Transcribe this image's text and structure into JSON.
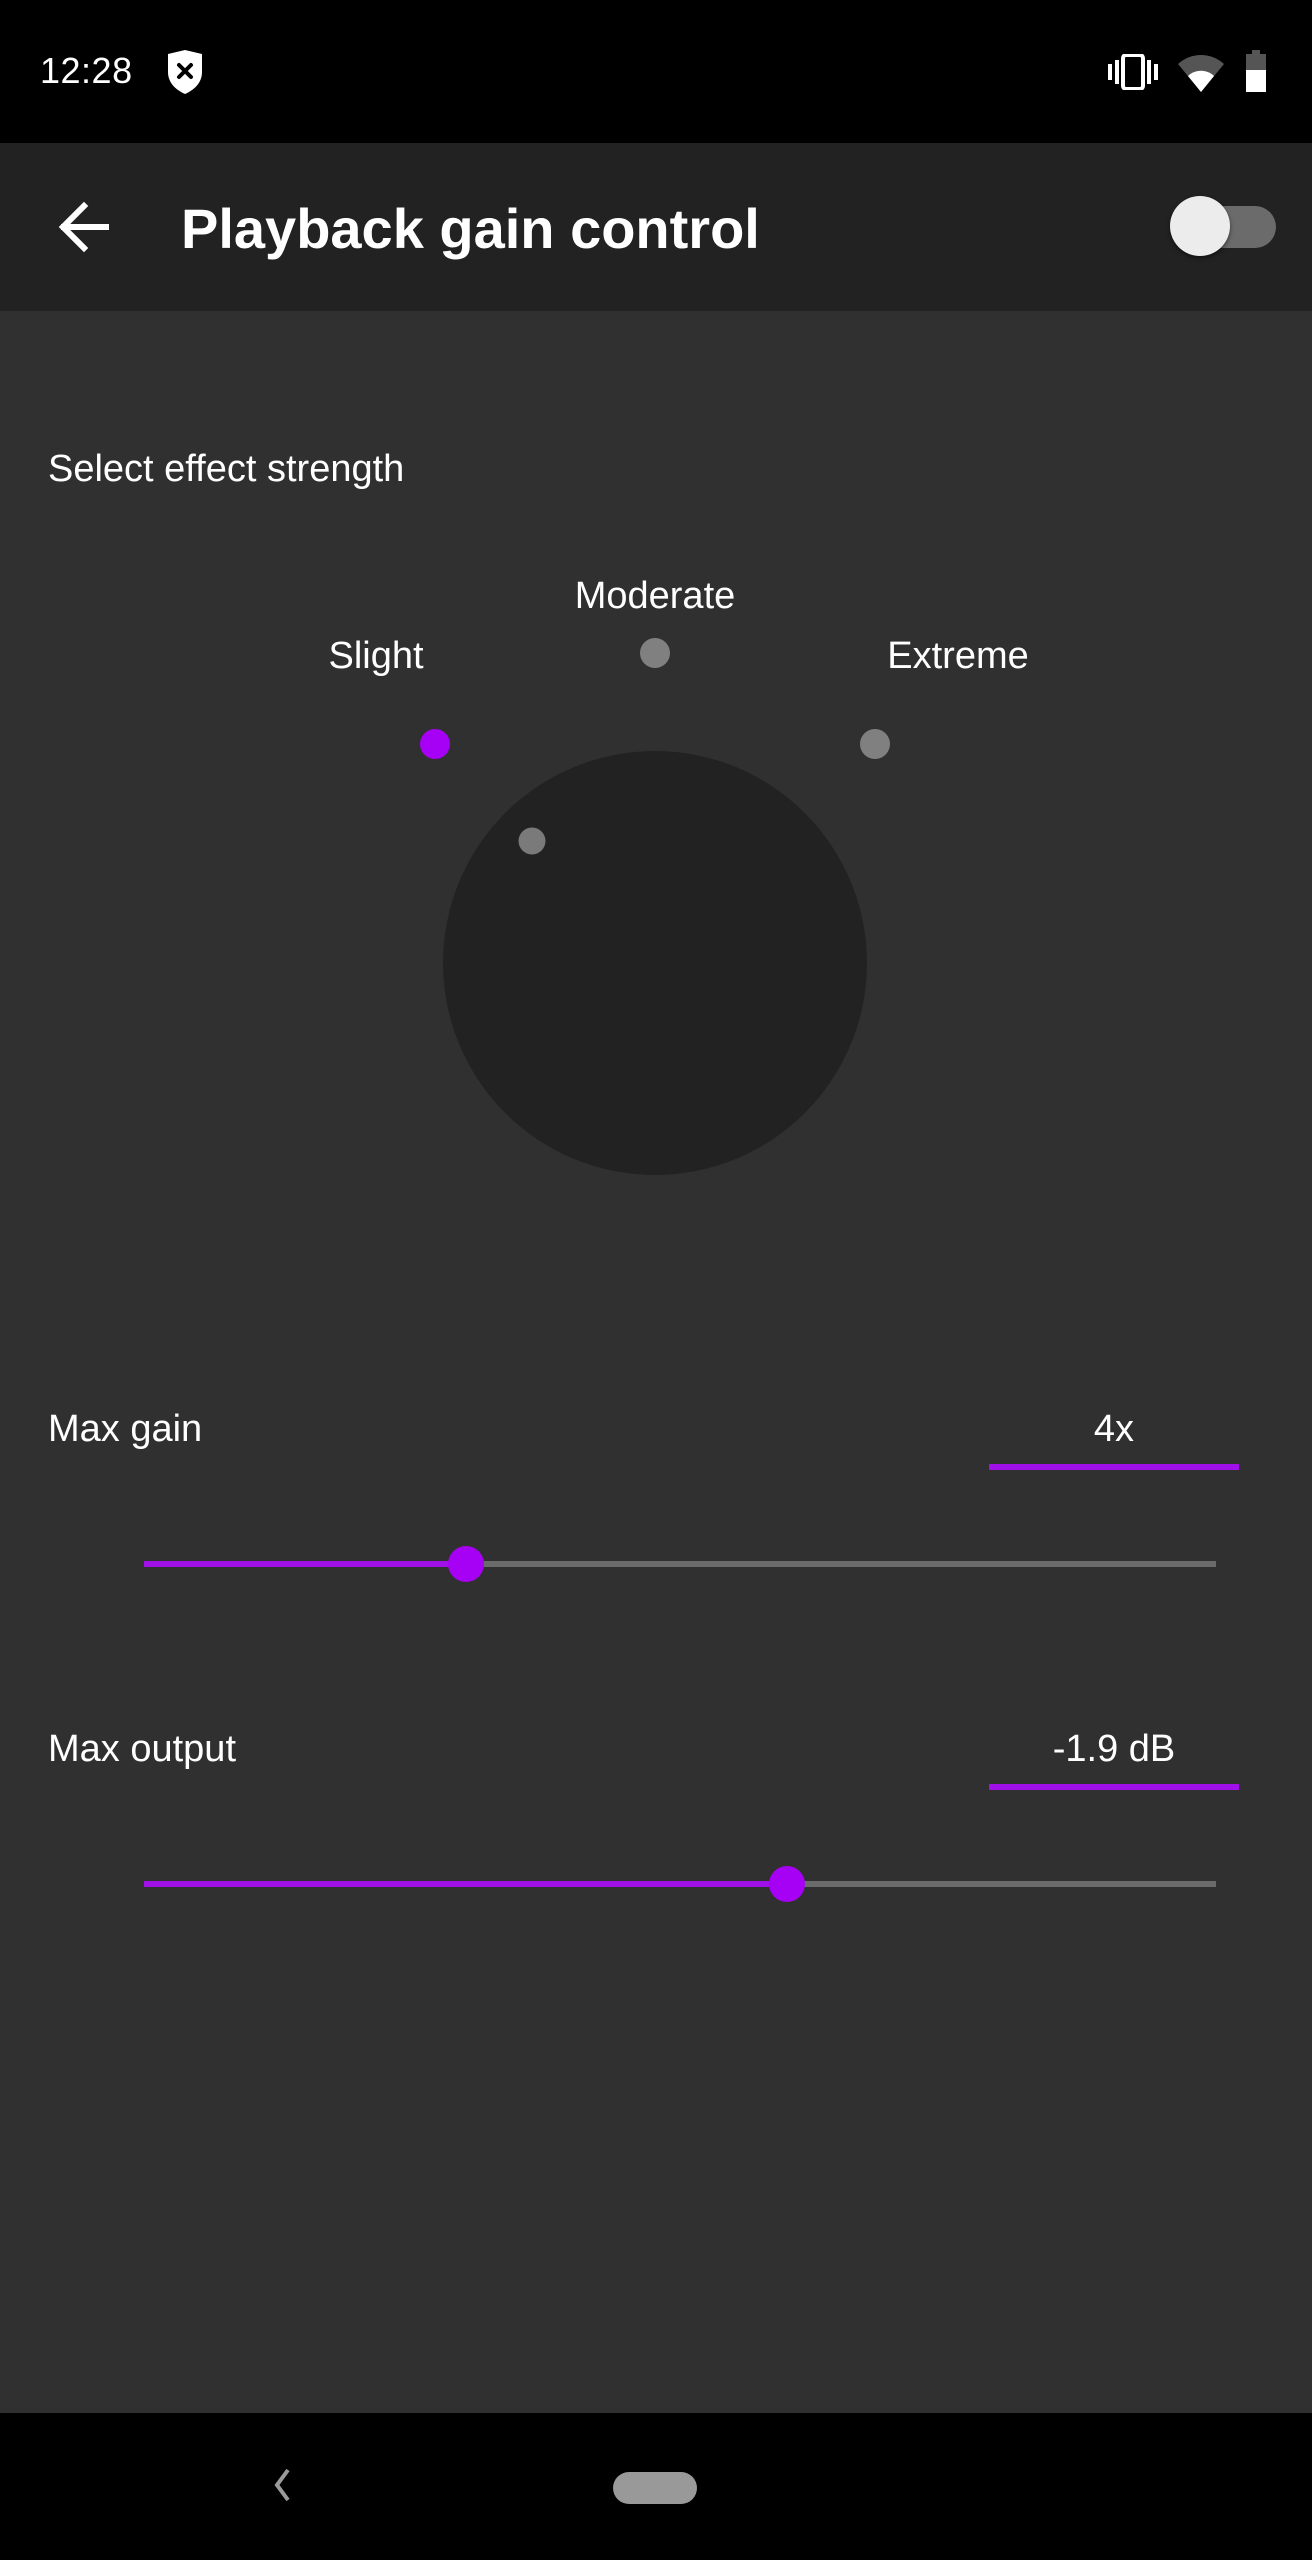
{
  "status_bar": {
    "time": "12:28",
    "left_icons": [
      "shield-x-icon"
    ],
    "right_icons": [
      "vibrate-icon",
      "wifi-icon",
      "battery-icon"
    ]
  },
  "app_bar": {
    "back_icon": "arrow-back-icon",
    "title": "Playback gain control",
    "master_toggle": {
      "state": "off"
    }
  },
  "effect_strength": {
    "label": "Select effect strength",
    "options": [
      {
        "label": "Slight",
        "selected": true
      },
      {
        "label": "Moderate",
        "selected": false
      },
      {
        "label": "Extreme",
        "selected": false
      }
    ],
    "selected": "Slight"
  },
  "max_gain": {
    "label": "Max gain",
    "value": "4x",
    "slider_fraction": 0.3
  },
  "max_output": {
    "label": "Max output",
    "value": "-1.9 dB",
    "slider_fraction": 0.6
  },
  "nav_bar": {
    "back_icon": "nav-back-icon",
    "home_icon": "nav-home-pill"
  },
  "colors": {
    "accent": "#a600f5",
    "background": "#303030",
    "app_bar": "#222222",
    "knob": "#222222",
    "inactive_dot": "#808080",
    "inactive_track": "#6b6b6b"
  }
}
